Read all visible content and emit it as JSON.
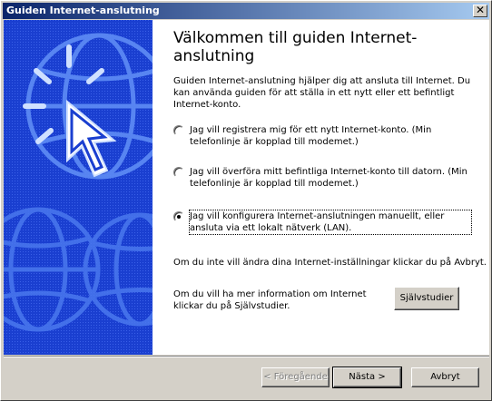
{
  "window": {
    "title": "Guiden Internet-anslutning",
    "close_glyph": "✕"
  },
  "heading": "Välkommen till guiden Internet-anslutning",
  "intro": "Guiden Internet-anslutning hjälper dig att ansluta till Internet. Du kan använda guiden för att ställa in ett nytt eller ett befintligt Internet-konto.",
  "options": [
    {
      "label": "Jag vill registrera mig för ett nytt Internet-konto. (Min telefonlinje är kopplad till modemet.)",
      "checked": false
    },
    {
      "label": "Jag vill överföra mitt befintliga Internet-konto till datorn. (Min telefonlinje är kopplad till modemet.)",
      "checked": false
    },
    {
      "label": "Jag vill konfigurera Internet-anslutningen manuellt, eller ansluta via ett lokalt nätverk (LAN).",
      "checked": true
    }
  ],
  "cancel_note": "Om du inte vill ändra dina Internet-inställningar klickar du på Avbryt.",
  "tutorial_note": "Om du vill ha mer information om Internet klickar du på Självstudier.",
  "buttons": {
    "tutorial": "Självstudier",
    "back": "< Föregående",
    "next": "Nästa >",
    "cancel": "Avbryt"
  },
  "colors": {
    "side_panel": "#1a3fd0",
    "graphic": "#7fb0ff",
    "accent": "#ffffff"
  },
  "icons": {
    "close": "close-icon",
    "side_graphic": "globe-cursor-graphic"
  }
}
